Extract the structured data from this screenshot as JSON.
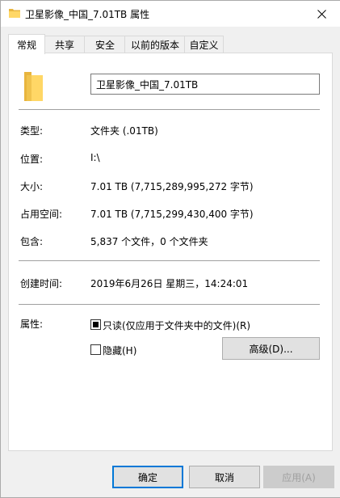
{
  "window": {
    "title": "卫星影像_中国_7.01TB 属性",
    "close_glyph": "✕"
  },
  "tabs": [
    {
      "label": "常规",
      "active": true
    },
    {
      "label": "共享",
      "active": false
    },
    {
      "label": "安全",
      "active": false
    },
    {
      "label": "以前的版本",
      "active": false
    },
    {
      "label": "自定义",
      "active": false
    }
  ],
  "general": {
    "name": "卫星影像_中国_7.01TB",
    "type_label": "类型:",
    "type_value": "文件夹 (.01TB)",
    "location_label": "位置:",
    "location_value": "I:\\",
    "size_label": "大小:",
    "size_value": "7.01 TB (7,715,289,995,272 字节)",
    "size_on_disk_label": "占用空间:",
    "size_on_disk_value": "7.01 TB (7,715,299,430,400 字节)",
    "contains_label": "包含:",
    "contains_value": "5,837 个文件，0 个文件夹",
    "created_label": "创建时间:",
    "created_value": "2019年6月26日 星期三，14:24:01",
    "attributes_label": "属性:",
    "readonly_label": "只读(仅应用于文件夹中的文件)(R)",
    "readonly_state": "indeterminate",
    "hidden_label": "隐藏(H)",
    "hidden_checked": false,
    "advanced_button": "高级(D)..."
  },
  "buttons": {
    "ok": "确定",
    "cancel": "取消",
    "apply": "应用(A)"
  },
  "colors": {
    "folder_yellow": "#ffd766",
    "folder_dark": "#e8b53e",
    "accent_blue": "#0078d7"
  }
}
